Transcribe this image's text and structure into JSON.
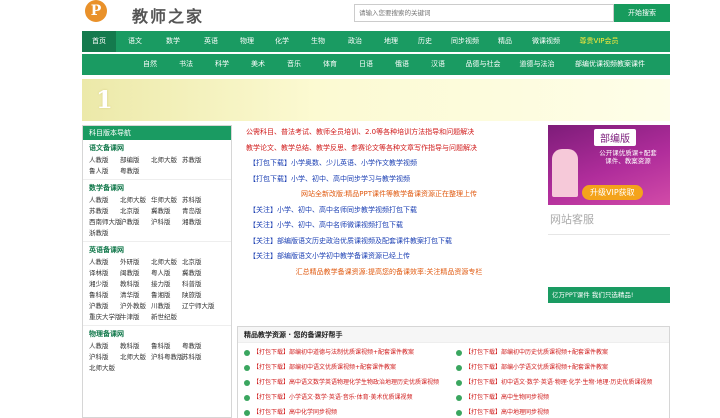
{
  "header": {
    "logo_letter": "P",
    "site_name": "教师之家",
    "search_placeholder": "请输入您要搜索的关键词",
    "search_button": "开始搜索"
  },
  "nav_primary": [
    {
      "label": "首页",
      "active": true
    },
    {
      "label": "语文"
    },
    {
      "label": "数学"
    },
    {
      "label": "英语"
    },
    {
      "label": "物理"
    },
    {
      "label": "化学"
    },
    {
      "label": "生物"
    },
    {
      "label": "政治"
    },
    {
      "label": "地理"
    },
    {
      "label": "历史"
    },
    {
      "label": "同步视频"
    },
    {
      "label": "精品"
    },
    {
      "label": "微课视频"
    },
    {
      "label": "尊贵VIP会员",
      "vip": true
    }
  ],
  "nav_secondary": [
    "自然",
    "书法",
    "科学",
    "美术",
    "音乐",
    "体育",
    "日语",
    "俄语",
    "汉语",
    "品德与社会",
    "道德与法治",
    "部编优课视频教案课件"
  ],
  "banner": {
    "number": "1"
  },
  "left_nav": {
    "title": "科目版本导航",
    "sections": [
      {
        "title": "语文备课网",
        "items": [
          "人教版",
          "部编版",
          "北师大版",
          "苏教版",
          "鲁人版",
          "粤教版"
        ]
      },
      {
        "title": "数学备课网",
        "items": [
          "人教版",
          "北师大版",
          "华师大版",
          "苏科版",
          "苏教版",
          "北京版",
          "冀教版",
          "青岛版",
          "西南师大版",
          "沪教版",
          "沪科版",
          "湘教版",
          "浙教版"
        ]
      },
      {
        "title": "英语备课网",
        "items": [
          "人教版",
          "外研版",
          "北师大版",
          "北京版",
          "译林版",
          "闽教版",
          "粤人版",
          "冀教版",
          "湘少版",
          "教科版",
          "接力版",
          "科普版",
          "鲁科版",
          "清华版",
          "鲁湘版",
          "陕旅版",
          "沪教版",
          "沪外教版",
          "川教版",
          "辽宁师大版",
          "重庆大学版",
          "牛津版",
          "新世纪版"
        ]
      },
      {
        "title": "物理备课网",
        "items": [
          "人教版",
          "教科版",
          "鲁科版",
          "粤教版",
          "沪科版",
          "北师大版",
          "沪科粤教版",
          "苏科版",
          "北师大版"
        ]
      }
    ]
  },
  "center_lines": [
    {
      "text": "公需科目、普法考试、教师全员培训、2.0等各种培训方法指导和问题解决",
      "style": "red"
    },
    {
      "text": "教学论文、教学总结、教学反思、参赛论文等各种文章写作指导与问题解决",
      "style": "red"
    },
    {
      "text": "【打包下载】小学奥数、少儿英语、小学作文教学视频",
      "style": "blue"
    },
    {
      "text": "【打包下载】小学、初中、高中同步学习与教学视频",
      "style": "blue"
    },
    {
      "text": "网站全新改版:精品PPT课件等教学备课资源正在整理上传",
      "style": "orange"
    },
    {
      "text": "【关注】小学、初中、高中名师同步教学视频打包下载",
      "style": "blue"
    },
    {
      "text": "【关注】小学、初中、高中名师微课视频打包下载",
      "style": "blue"
    },
    {
      "text": "【关注】部编版语文历史政治优质课视频及配套课件教案打包下载",
      "style": "blue"
    },
    {
      "text": "【关注】部编版语文小学初中教学备课资源已经上传",
      "style": "blue"
    },
    {
      "text": "汇总精品教学备课资源:提高您的备课效率:关注精品资源专栏",
      "style": "orange"
    }
  ],
  "right_ad": {
    "title": "部编版",
    "subtitle_1": "公开课优质课+配套",
    "subtitle_2": "课件、教案资源",
    "button": "升级VIP获取"
  },
  "customer_service": "网站客服",
  "template_bar": "亿万PPT课件  我们只选精品!",
  "helper": {
    "title": "精品教学资源 · 您的备课好帮手",
    "items": [
      "【打包下载】部编初中道德与法制优质课视频+配套课件教案",
      "【打包下载】部编初中历史优质课视频+配套课件教案",
      "【打包下载】部编初中语文优质课视频+配套课件教案",
      "【打包下载】部编小学语文优质课视频+配套课件教案",
      "【打包下载】高中语文数学英语物理化学生物政治地理历史优质课视频",
      "【打包下载】初中语文·数学·英语·物理·化学·生物·地理·历史优质课视频",
      "【打包下载】小学语文·数学·英语·音乐·体育·美术优质课视频",
      "【打包下载】高中生物同步视频",
      "【打包下载】高中化学同步视频",
      "【打包下载】高中地理同步视频"
    ]
  }
}
